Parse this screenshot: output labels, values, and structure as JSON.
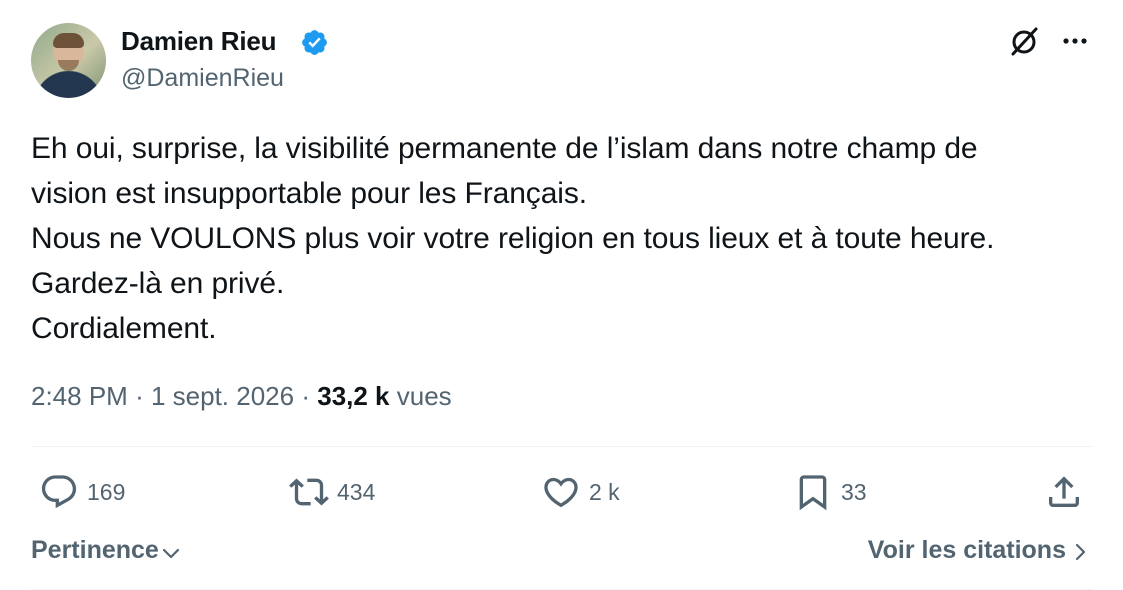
{
  "author": {
    "name": "Damien Rieu",
    "handle": "@DamienRieu",
    "verified": true
  },
  "icons": {
    "avatar": "avatar",
    "verified": "verified-badge-icon",
    "grok": "grok-icon",
    "more": "more-icon",
    "reply": "reply-icon",
    "retweet": "retweet-icon",
    "like": "like-icon",
    "bookmark": "bookmark-icon",
    "share": "share-icon",
    "chevron_down": "chevron-down-icon",
    "chevron_right": "chevron-right-icon"
  },
  "colors": {
    "verified": "#1d9bf0",
    "secondary_text": "#536471",
    "primary_text": "#0f1419"
  },
  "tweet": {
    "lines": [
      "Eh oui, surprise, la visibilité permanente de l’islam dans notre champ de",
      "vision est insupportable pour les Français.",
      "Nous ne VOULONS plus voir votre religion en tous lieux et à toute heure.",
      "Gardez-là en privé.",
      "Cordialement."
    ]
  },
  "meta": {
    "time": "2:48 PM",
    "separator": "·",
    "date": "1 sept. 2026",
    "views_count": "33,2 k",
    "views_label": "vues"
  },
  "actions": {
    "replies": "169",
    "reposts": "434",
    "likes": "2 k",
    "bookmarks": "33"
  },
  "footer": {
    "sort_label": "Pertinence",
    "quotes_label": "Voir les citations"
  }
}
